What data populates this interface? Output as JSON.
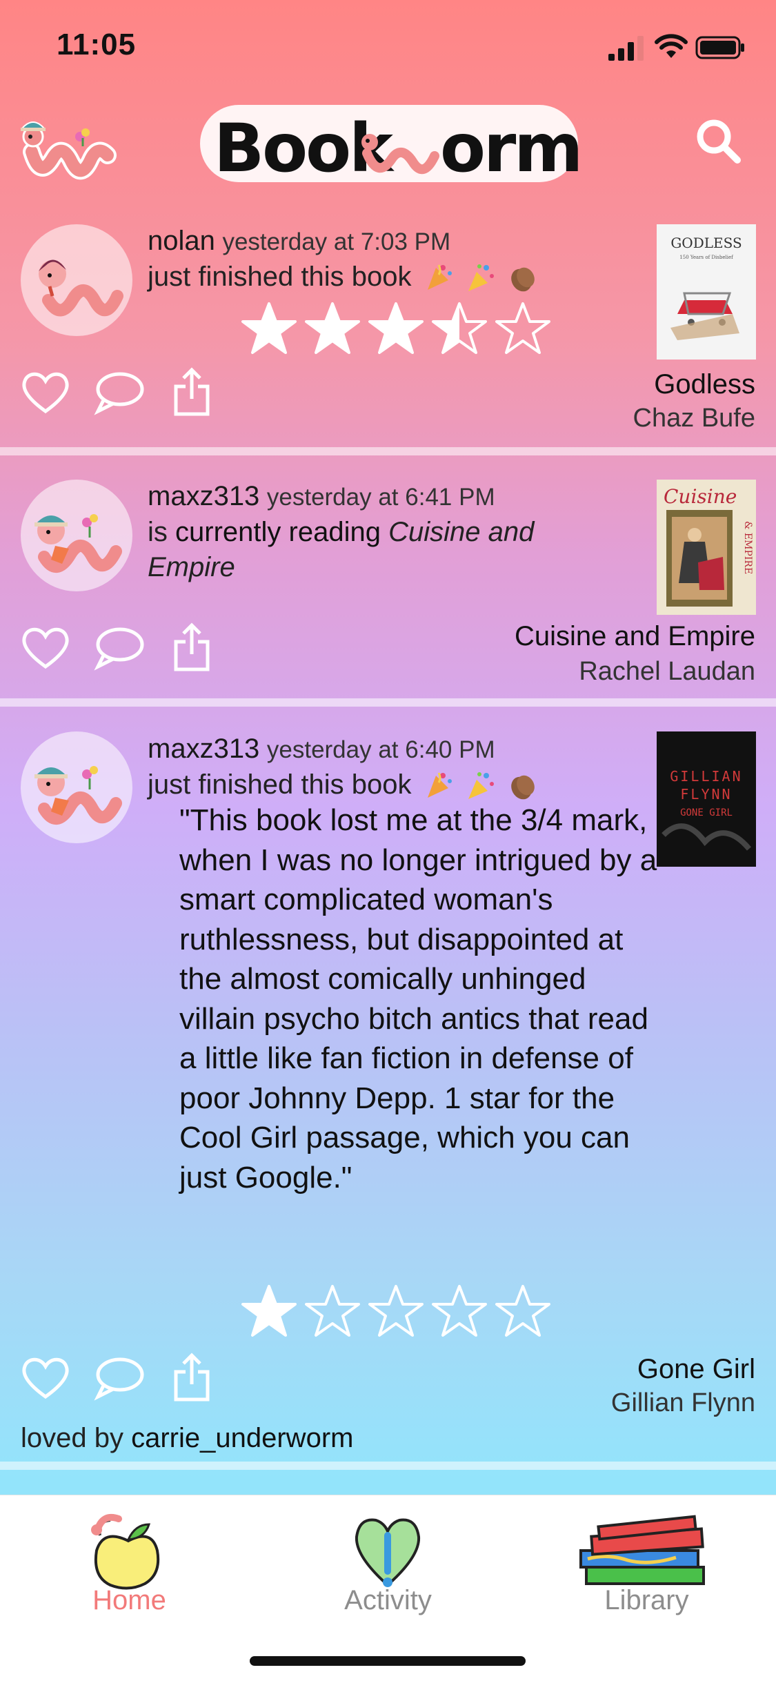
{
  "status_bar": {
    "time": "11:05"
  },
  "app": {
    "brand_name": "BookWorm",
    "accent": "#f27a7a"
  },
  "feed": [
    {
      "user": "nolan",
      "timestamp": "yesterday at 7:03 PM",
      "action_text": "just finished this book",
      "rating": 3.5,
      "book_title": "Godless",
      "book_author": "Chaz Bufe",
      "cover": {
        "title": "GODLESS",
        "subtitle": "150 Years of Disbelief"
      }
    },
    {
      "user": "maxz313",
      "timestamp": "yesterday at 6:41 PM",
      "action_prefix": "is",
      "action_bold": "currently reading",
      "action_italic": "Cuisine and Empire",
      "book_title": "Cuisine and Empire",
      "book_author": "Rachel Laudan",
      "cover": {
        "title": "Cuisine",
        "subtitle": "& EMPIRE"
      }
    },
    {
      "user": "maxz313",
      "timestamp": "yesterday at 6:40 PM",
      "action_text": "just finished this book",
      "review": "\"This book lost me at the 3/4 mark, when I was no longer intrigued by a smart complicated woman's ruthlessness, but disappointed at the almost comically unhinged villain psycho bitch antics that read a little like fan fiction in defense of poor Johnny Depp. 1 star for the Cool Girl passage, which you can just Google.\"",
      "rating": 1,
      "book_title": "Gone Girl",
      "book_author": "Gillian Flynn",
      "loved_by_prefix": "loved by",
      "loved_by_user": "carrie_underworm",
      "cover": {
        "title_line1": "GILLIAN",
        "title_line2": "FLYNN",
        "title_line3": "GONE GIRL"
      }
    }
  ],
  "tabs": [
    {
      "label": "Home",
      "icon": "apple-icon",
      "active": true
    },
    {
      "label": "Activity",
      "icon": "heart-exclamation-icon",
      "active": false
    },
    {
      "label": "Library",
      "icon": "books-stack-icon",
      "active": false
    }
  ]
}
